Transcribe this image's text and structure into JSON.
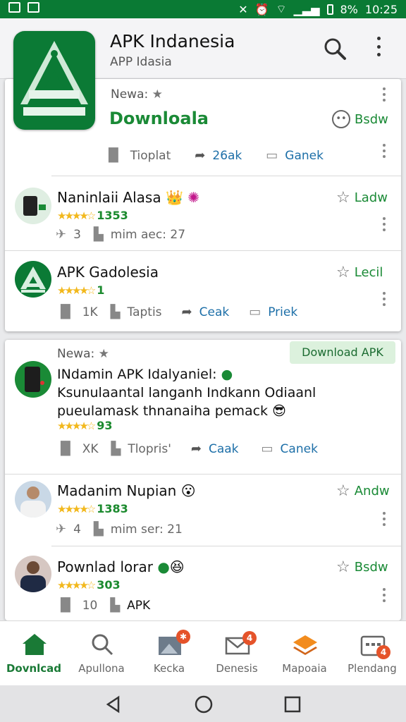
{
  "status_bar": {
    "battery": "8%",
    "time": "10:25"
  },
  "header": {
    "title": "APK Indanesia",
    "subtitle": "APP Idasia"
  },
  "featured": {
    "tag": "Newa:",
    "title": "Downloala",
    "action_label": "Bsdw",
    "meta": [
      "Tioplat",
      "26ak",
      "Ganek"
    ]
  },
  "list1": [
    {
      "name": "Naninlaii Alasa",
      "rating": "1353",
      "action": "Ladw",
      "meta": [
        "3",
        "mim aec:",
        "27"
      ]
    },
    {
      "name": "APK Gadolesia",
      "rating": "1",
      "action": "Lecil",
      "meta": [
        "1K",
        "Taptis",
        "Ceak",
        "Priek"
      ]
    }
  ],
  "featured2": {
    "tag": "Newa:",
    "download_label": "Download APK",
    "title_lines": [
      "INdamin APK Idalyaniel:",
      "Ksunulaantal langanh Indkann Odiaanl",
      "pueulamask thnanaiha pemack"
    ],
    "rating": "93",
    "meta": [
      "XK",
      "Tlopris'",
      "Caak",
      "Canek"
    ]
  },
  "list2": [
    {
      "name": "Madanim Nupian",
      "rating": "1383",
      "action": "Andw",
      "meta": [
        "4",
        "mim ser:",
        "21"
      ]
    },
    {
      "name": "Pownlad lorar",
      "rating": "303",
      "action": "Bsdw",
      "meta": [
        "10",
        "APK"
      ]
    }
  ],
  "bottom_nav": [
    {
      "label": "Dovnlcad",
      "icon": "home-icon",
      "active": true
    },
    {
      "label": "Apullona",
      "icon": "search-icon"
    },
    {
      "label": "Kecka",
      "icon": "image-icon",
      "badge": "✱"
    },
    {
      "label": "Denesis",
      "icon": "mail-icon",
      "badge": "4"
    },
    {
      "label": "Mapoaia",
      "icon": "layers-icon"
    },
    {
      "label": "Plendang",
      "icon": "calendar-icon",
      "badge": "4"
    }
  ],
  "colors": {
    "brand": "#0b7a35",
    "accent_text": "#1a8a36",
    "star": "#f2b81c",
    "link": "#1d6fa8"
  }
}
